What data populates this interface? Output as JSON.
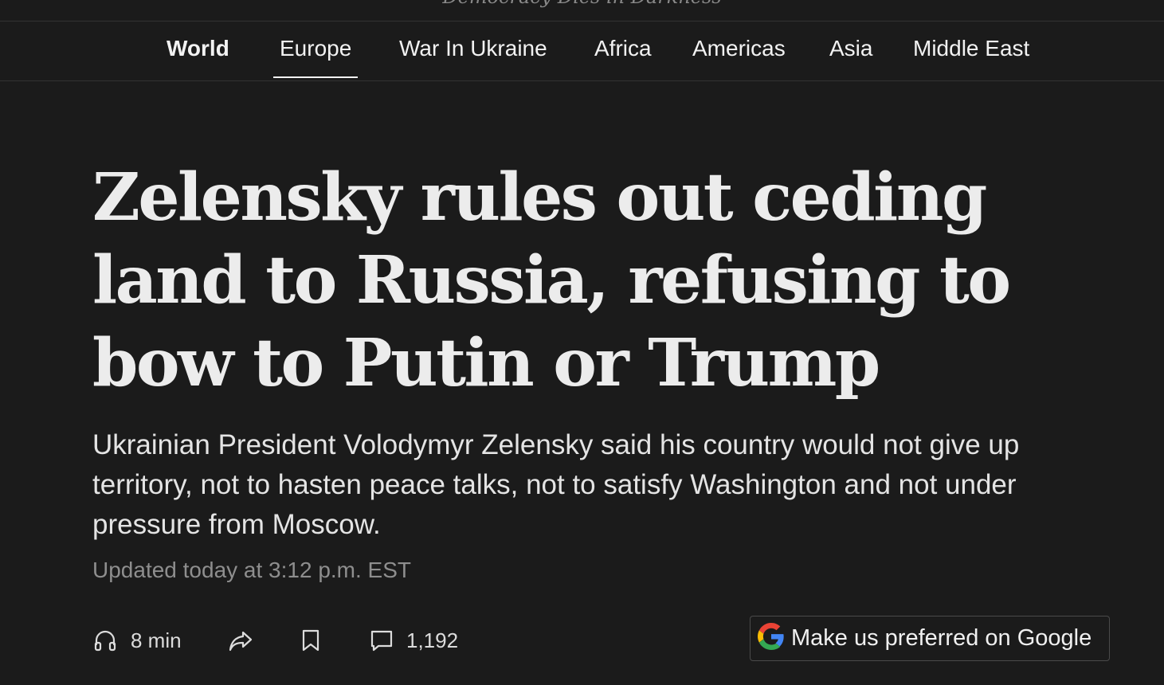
{
  "masthead": {
    "slogan": "Democracy Dies in Darkness"
  },
  "nav": {
    "items": [
      {
        "label": "World"
      },
      {
        "label": "Europe"
      },
      {
        "label": "War In Ukraine"
      },
      {
        "label": "Africa"
      },
      {
        "label": "Americas"
      },
      {
        "label": "Asia"
      },
      {
        "label": "Middle East"
      }
    ],
    "active": "Europe"
  },
  "article": {
    "headline": "Zelensky rules out ceding land to Russia, refusing to bow to Putin or Trump",
    "dek": "Ukrainian President Volodymyr Zelensky said his country would not give up territory, not to hasten peace talks, not to satisfy Washington and not under pressure from Moscow.",
    "updated": "Updated today at 3:12 p.m. EST"
  },
  "toolbar": {
    "listen_icon": "headphones-icon",
    "listen_duration": "8 min",
    "share_icon": "share-arrow-icon",
    "save_icon": "bookmark-icon",
    "comments_icon": "comment-bubble-icon",
    "comments_count": "1,192",
    "google_icon": "google-g-icon",
    "google_label": "Make us preferred on Google"
  },
  "colors": {
    "background": "#1b1b1b",
    "text": "#ececec",
    "muted": "#8e8e8e",
    "google_blue": "#4285F4",
    "google_red": "#EA4335",
    "google_yellow": "#FBBC05",
    "google_green": "#34A853"
  }
}
